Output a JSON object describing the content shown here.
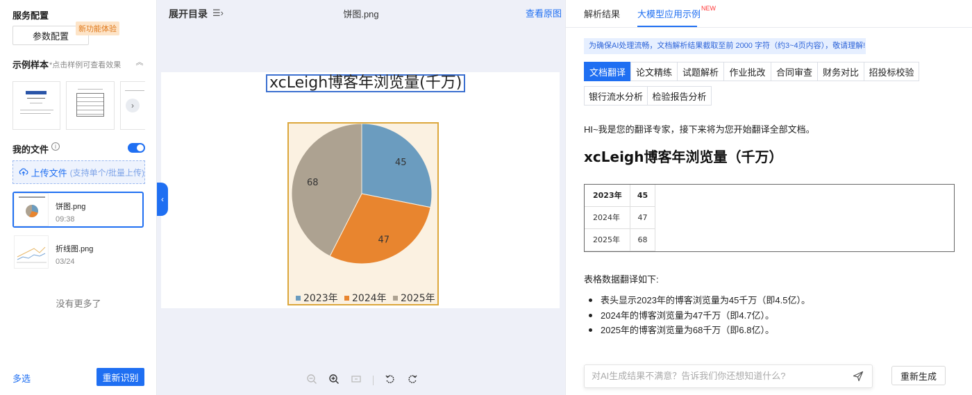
{
  "left_panel": {
    "service_config_title": "服务配置",
    "param_button": "参数配置",
    "new_feature_badge": "新功能体验",
    "samples_title": "示例样本",
    "samples_hint": "*点击样例可查看效果",
    "my_files_title": "我的文件",
    "upload_label": "上传文件",
    "upload_hint": "(支持单个/批量上传)",
    "files": [
      {
        "name": "饼图.png",
        "time": "09:38"
      },
      {
        "name": "折线图.png",
        "time": "03/24"
      }
    ],
    "no_more": "没有更多了",
    "multi_select": "多选",
    "re_recognize": "重新识别"
  },
  "middle_panel": {
    "expand_toc": "展开目录",
    "filename": "饼图.png",
    "view_original": "查看原图"
  },
  "chart_data": {
    "type": "pie",
    "title": "xcLeigh博客年浏览量(千万)",
    "categories": [
      "2023年",
      "2024年",
      "2025年"
    ],
    "values": [
      45,
      47,
      68
    ],
    "colors": [
      "#6b9cbf",
      "#e8852f",
      "#ada291"
    ],
    "legend_position": "bottom"
  },
  "right_panel": {
    "tabs": [
      "解析结果",
      "大模型应用示例"
    ],
    "new_tag": "NEW",
    "notice": "为确保AI处理流畅，文档解析结果截取至前 2000 字符（约3~4页内容），敬请理解!",
    "function_buttons": [
      "文档翻译",
      "论文精练",
      "试题解析",
      "作业批改",
      "合同审查",
      "财务对比",
      "招投标校验",
      "银行流水分析",
      "检验报告分析"
    ],
    "greeting": "HI~我是您的翻译专家，接下来将为您开始翻译全部文档。",
    "doc_title": "xcLeigh博客年浏览量（千万）",
    "table": [
      [
        "2023年",
        "45"
      ],
      [
        "2024年",
        "47"
      ],
      [
        "2025年",
        "68"
      ]
    ],
    "translation_label": "表格数据翻译如下:",
    "bullets": [
      "表头显示2023年的博客浏览量为45千万（即4.5亿）。",
      "2024年的博客浏览量为47千万（即4.7亿）。",
      "2025年的博客浏览量为68千万（即6.8亿）。"
    ],
    "input_placeholder": "对AI生成结果不满意？告诉我们你还想知道什么?",
    "regenerate": "重新生成"
  }
}
